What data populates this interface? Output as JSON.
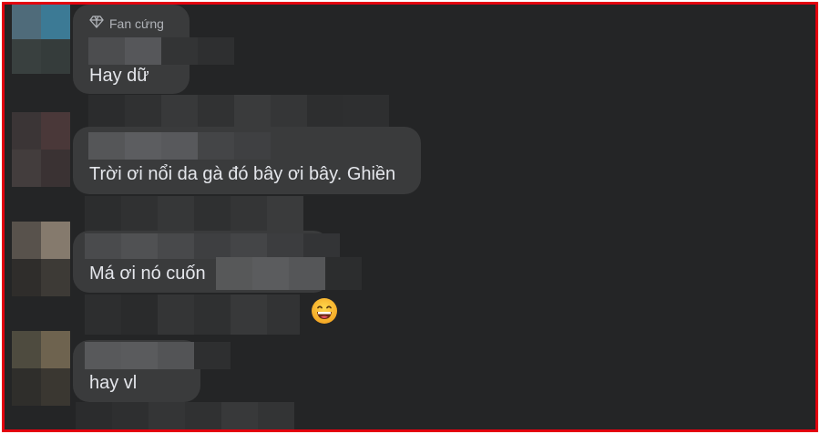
{
  "comments": [
    {
      "badge_icon": "diamond-icon",
      "badge": "Fan cứng",
      "text": "Hay dữ"
    },
    {
      "text": "Trời ơi nổi da gà đó bây ơi bây. Ghiền"
    },
    {
      "text": "Má ơi nó cuốn"
    },
    {
      "reaction_icon": "grinning-emoji-icon"
    },
    {
      "text": "hay vl"
    }
  ],
  "colors": {
    "frame_border": "#e3000f",
    "background": "#242526",
    "bubble": "#3a3b3c",
    "text": "#e4e6eb",
    "badge_text": "#b0b3b8"
  }
}
